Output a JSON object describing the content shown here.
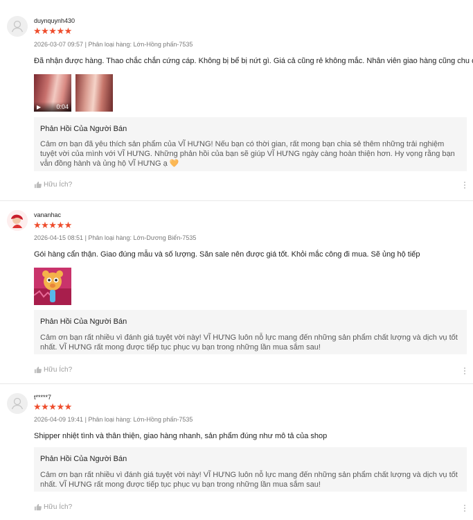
{
  "reviews": [
    {
      "username": "duynquynh430",
      "stars": "★★★★★",
      "date": "2026-03-07 09:57",
      "variation": "Phân loại hàng: Lớn-Hồng phấn-7535",
      "comment": "Đã nhận được hàng. Thao chắc chắn cứng cáp. Không bị bể bị nứt gì. Giá cả cũng rẻ không mắc. Nhân viên giao hàng cũng chu đáo",
      "video_duration": "0:04",
      "reply_title": "Phản Hồi Của Người Bán",
      "reply_text": "Cảm ơn bạn đã yêu thích sản phẩm của VĨ HƯNG! Nếu bạn có thời gian, rất mong bạn chia sẻ thêm những trải nghiệm tuyệt vời của mình với VĨ HƯNG. Những phản hồi của bạn sẽ giúp VĨ HƯNG ngày càng hoàn thiện hơn. Hy vọng rằng bạn vẫn đồng hành và ủng hộ VĨ HƯNG ạ 🧡",
      "helpful": "Hữu Ích?"
    },
    {
      "username": "vananhac",
      "stars": "★★★★★",
      "date": "2026-04-15 08:51",
      "variation": "Phân loại hàng: Lớn-Dương Biển-7535",
      "comment": "Gói hàng cẩn thận. Giao đúng mẫu và số lượng. Săn sale nên được giá tốt. Khỏi mắc công đi mua. Sẽ ủng hộ tiếp",
      "reply_title": "Phản Hồi Của Người Bán",
      "reply_text": "Cảm ơn bạn rất nhiều vì đánh giá tuyệt vời này! VĨ HƯNG luôn nỗ lực mang đến những sản phẩm chất lượng và dịch vụ tốt nhất. VĨ HƯNG rất mong được tiếp tục phục vụ bạn trong những lần mua sắm sau!",
      "helpful": "Hữu Ích?"
    },
    {
      "username": "t*****7",
      "stars": "★★★★★",
      "date": "2026-04-09 19:41",
      "variation": "Phân loại hàng: Lớn-Hồng phấn-7535",
      "comment": "Shipper nhiệt tình và thân thiện, giao hàng nhanh, sản phẩm đúng như mô tả của shop",
      "reply_title": "Phản Hồi Của Người Bán",
      "reply_text": "Cảm ơn bạn rất nhiều vì đánh giá tuyệt vời này! VĨ HƯNG luôn nỗ lực mang đến những sản phẩm chất lượng và dịch vụ tốt nhất. VĨ HƯNG rất mong được tiếp tục phục vụ bạn trong những lần mua sắm sau!",
      "helpful": "Hữu Ích?"
    }
  ],
  "colors": {
    "star": "#ee4d2d",
    "reply_bg": "#f5f5f5"
  }
}
